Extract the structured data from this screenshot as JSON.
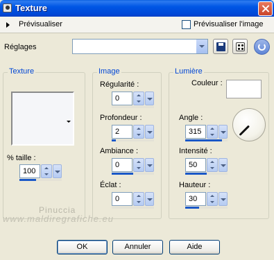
{
  "window": {
    "title": "Texture"
  },
  "preview": {
    "label": "Prévisualiser",
    "checkbox_label": "Prévisualiser l'image",
    "checked": false
  },
  "presets": {
    "label": "Réglages",
    "value": ""
  },
  "texture_group": {
    "title": "Texture",
    "size_label": "% taille :",
    "size_value": "100",
    "size_level": 0.4
  },
  "image_group": {
    "title": "Image",
    "regularity_label": "Régularité :",
    "regularity_value": "0",
    "regularity_level": 0.0,
    "depth_label": "Profondeur :",
    "depth_value": "2",
    "depth_level": 0.1,
    "ambiance_label": "Ambiance :",
    "ambiance_value": "0",
    "ambiance_level": 0.5,
    "glare_label": "Éclat :",
    "glare_value": "0",
    "glare_level": 0.0
  },
  "light_group": {
    "title": "Lumière",
    "color_label": "Couleur :",
    "color_value": "#FFFFFF",
    "angle_label": "Angle :",
    "angle_value": "315",
    "angle_level": 0.875,
    "intensity_label": "Intensité :",
    "intensity_value": "50",
    "intensity_level": 0.5,
    "height_label": "Hauteur :",
    "height_value": "30",
    "height_level": 0.33
  },
  "buttons": {
    "ok": "OK",
    "cancel": "Annuler",
    "help": "Aide"
  },
  "watermark": {
    "line1": "Pinuccia",
    "line2": "www.maldiregrafiche.eu"
  }
}
